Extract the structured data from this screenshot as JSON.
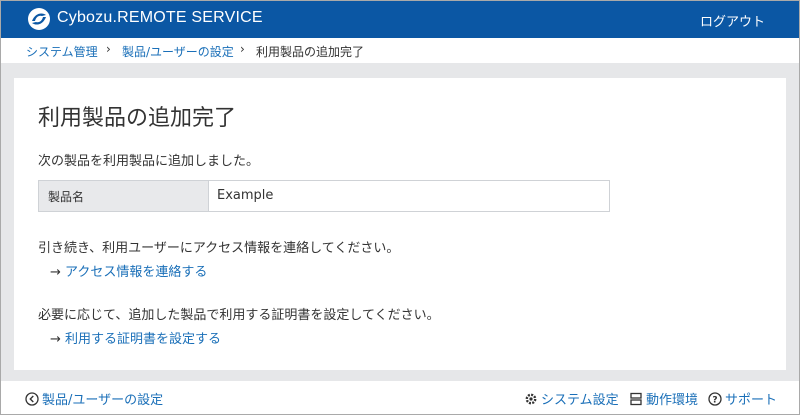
{
  "header": {
    "logo_text": "Cybozu.REMOTE SERVICE",
    "logout_label": "ログアウト",
    "bg_color": "#0b57a4"
  },
  "breadcrumb": {
    "items": [
      "システム管理",
      "製品/ユーザーの設定",
      "利用製品の追加完了"
    ],
    "separator": "›"
  },
  "main": {
    "title": "利用製品の追加完了",
    "message": "次の製品を利用製品に追加しました。",
    "table": {
      "header": "製品名",
      "value": "Example"
    },
    "access_instruction": "引き続き、利用ユーザーにアクセス情報を連絡してください。",
    "access_link": "アクセス情報を連絡する",
    "cert_instruction": "必要に応じて、追加した製品で利用する証明書を設定してください。",
    "cert_link": "利用する証明書を設定する",
    "arrow": "→"
  },
  "footer": {
    "back_label": "製品/ユーザーの設定",
    "system_settings_label": "システム設定",
    "environment_label": "動作環境",
    "support_label": "サポート"
  },
  "icons": {
    "logo": "cybozu-logo-icon",
    "back": "back-circle-icon",
    "settings": "gear-icon",
    "environment": "server-icon",
    "support": "help-circle-icon"
  }
}
